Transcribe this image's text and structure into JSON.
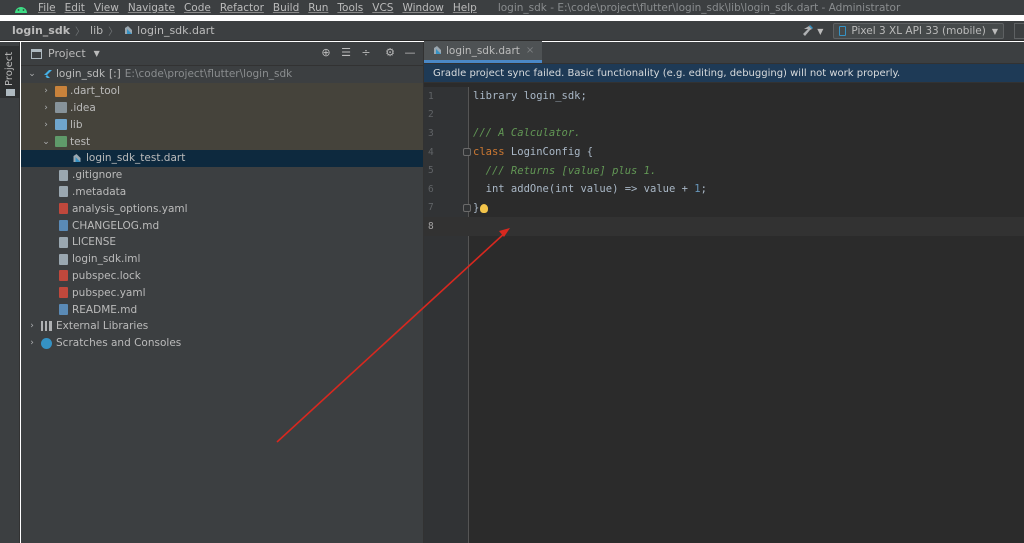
{
  "menubar": {
    "items": [
      "File",
      "Edit",
      "View",
      "Navigate",
      "Code",
      "Refactor",
      "Build",
      "Run",
      "Tools",
      "VCS",
      "Window",
      "Help"
    ],
    "window_title": "login_sdk - E:\\code\\project\\flutter\\login_sdk\\lib\\login_sdk.dart - Administrator"
  },
  "navbar": {
    "breadcrumbs": [
      "login_sdk",
      "lib",
      "login_sdk.dart"
    ],
    "device": "Pixel 3 XL API 33 (mobile)"
  },
  "stripe": {
    "label": "Project"
  },
  "project_panel": {
    "title": "Project",
    "tree": [
      {
        "label": "login_sdk",
        "suffix": "[:]",
        "path": "E:\\code\\project\\flutter\\login_sdk"
      },
      {
        "label": ".dart_tool"
      },
      {
        "label": ".idea"
      },
      {
        "label": "lib"
      },
      {
        "label": "test"
      },
      {
        "label": "login_sdk_test.dart"
      },
      {
        "label": ".gitignore"
      },
      {
        "label": ".metadata"
      },
      {
        "label": "analysis_options.yaml"
      },
      {
        "label": "CHANGELOG.md"
      },
      {
        "label": "LICENSE"
      },
      {
        "label": "login_sdk.iml"
      },
      {
        "label": "pubspec.lock"
      },
      {
        "label": "pubspec.yaml"
      },
      {
        "label": "README.md"
      },
      {
        "label": "External Libraries"
      },
      {
        "label": "Scratches and Consoles"
      }
    ]
  },
  "editor": {
    "tab": "login_sdk.dart",
    "banner": "Gradle project sync failed. Basic functionality (e.g. editing, debugging) will not work properly.",
    "line_numbers": [
      "1",
      "2",
      "3",
      "4",
      "5",
      "6",
      "7",
      "8"
    ],
    "code": {
      "l1_kw": "library",
      "l1_rest": " login_sdk;",
      "l3": "/// A Calculator.",
      "l4_kw": "class",
      "l4_rest": " LoginConfig {",
      "l5": "  /// Returns [value] plus 1.",
      "l6_a": "  int addOne(int value) => value + ",
      "l6_num": "1",
      "l6_b": ";",
      "l7": "}"
    }
  },
  "colors": {
    "accent": "#4a88c7",
    "arrow": "#d8281f",
    "banner_bg": "#1e3a56"
  },
  "icons": [
    "android-icon",
    "dart-file-icon",
    "hammer-icon",
    "phone-icon",
    "target-icon",
    "collapse-icon",
    "gear-icon",
    "minimize-icon",
    "folder-icon",
    "lightbulb-icon"
  ]
}
